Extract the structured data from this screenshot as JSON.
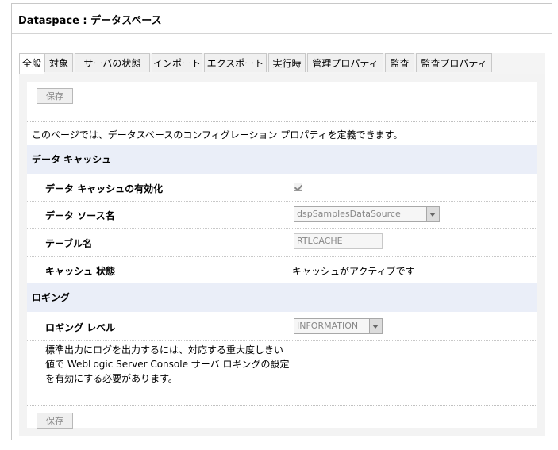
{
  "panel": {
    "title": "Dataspace : データスペース"
  },
  "tabs": [
    {
      "label": "全般",
      "active": true
    },
    {
      "label": "対象"
    },
    {
      "label": "サーバの状態"
    },
    {
      "label": "インポート"
    },
    {
      "label": "エクスポート"
    },
    {
      "label": "実行時"
    },
    {
      "label": "管理プロパティ"
    },
    {
      "label": "監査"
    },
    {
      "label": "監査プロパティ"
    }
  ],
  "buttons": {
    "save_top": "保存",
    "save_bottom": "保存"
  },
  "description": "このページでは、データスペースのコンフィグレーション プロパティを定義できます。",
  "data_cache": {
    "section_title": "データ キャッシュ",
    "enable_label": "データ キャッシュの有効化",
    "enable_checked": true,
    "datasource_label": "データ ソース名",
    "datasource_value": "dspSamplesDataSource",
    "table_label": "テーブル名",
    "table_value": "RTLCACHE",
    "status_label": "キャッシュ 状態",
    "status_value": "キャッシュがアクティブです"
  },
  "logging": {
    "section_title": "ロギング",
    "level_label": "ロギング レベル",
    "level_value": "INFORMATION",
    "note": "標準出力にログを出力するには、対応する重大度しきい値で WebLogic Server Console サーバ ロギングの設定を有効にする必要があります。"
  }
}
